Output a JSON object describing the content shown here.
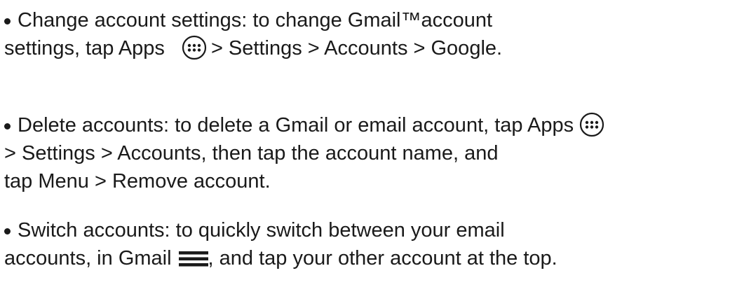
{
  "items": [
    {
      "line1": "Change account settings: to change Gmail™account",
      "line2_a": "settings, tap Apps",
      "line2_b": "> Settings > Accounts > Google."
    },
    {
      "line1_a": "Delete accounts: to delete a Gmail or email account, tap Apps",
      "line2": "> Settings > Accounts, then tap the account name, and",
      "line3": "tap Menu  > Remove account."
    },
    {
      "line1": "Switch accounts: to quickly switch between your email",
      "line2_a": "accounts, in Gmail",
      "line2_b": ", and tap your other account at the top."
    }
  ],
  "icons": {
    "apps": "apps-icon",
    "menu": "menu-icon"
  }
}
